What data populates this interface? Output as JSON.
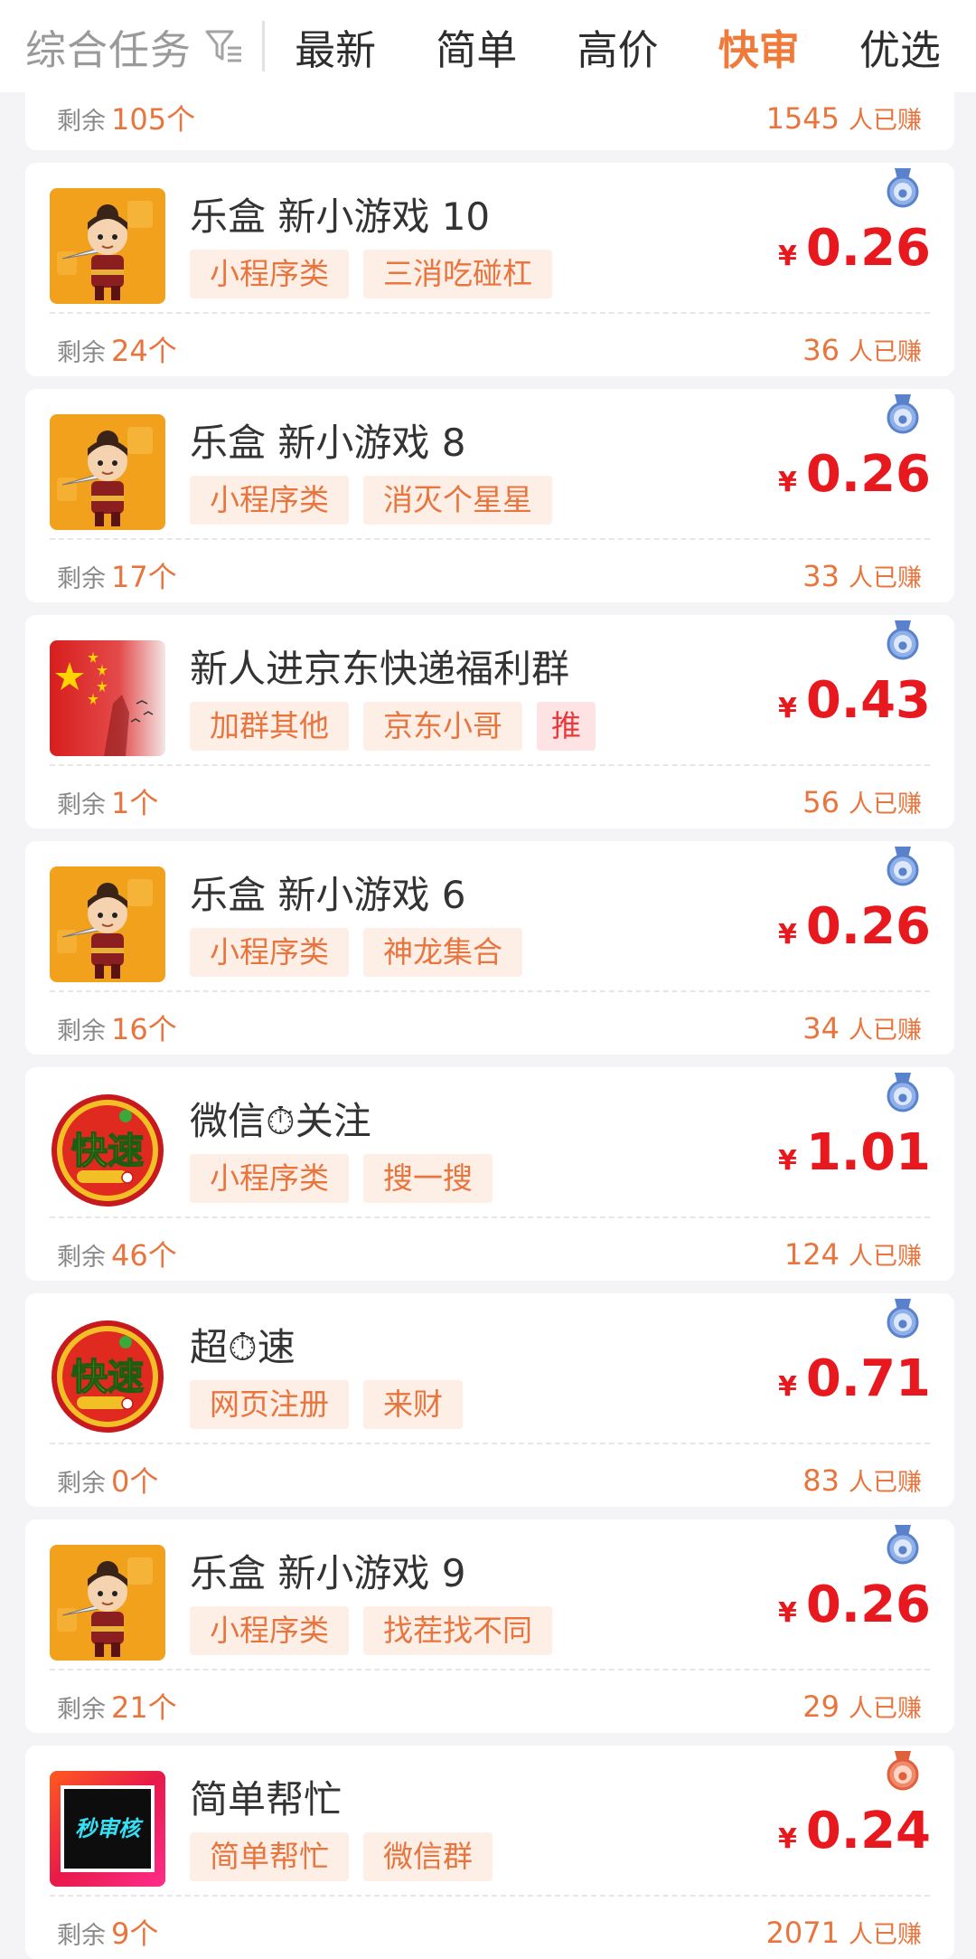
{
  "top_nav": {
    "filter_label": "综合任务",
    "tabs": [
      "最新",
      "简单",
      "高价",
      "快审",
      "优选"
    ],
    "active_tab": "快审"
  },
  "partial_card": {
    "remain_label": "剩余",
    "remain_count": "105个",
    "earned_count": "1545",
    "earned_label": "人已赚"
  },
  "cards": [
    {
      "title": "乐盒 新小游戏 10",
      "tags": [
        "小程序类",
        "三消吃碰杠"
      ],
      "price": "0.26",
      "remain_count": "24个",
      "earned_count": "36",
      "thumb": "ninja-game-icon",
      "medal": "silver-medal-icon"
    },
    {
      "title": "乐盒 新小游戏 8",
      "tags": [
        "小程序类",
        "消灭个星星"
      ],
      "price": "0.26",
      "remain_count": "17个",
      "earned_count": "33",
      "thumb": "ninja-game-icon",
      "medal": "silver-medal-icon"
    },
    {
      "title": "新人进京东快递福利群",
      "tags": [
        "加群其他",
        "京东小哥",
        "推"
      ],
      "price": "0.43",
      "remain_count": "1个",
      "earned_count": "56",
      "thumb": "china-flag-icon",
      "medal": "silver-medal-icon"
    },
    {
      "title": "乐盒 新小游戏 6",
      "tags": [
        "小程序类",
        "神龙集合"
      ],
      "price": "0.26",
      "remain_count": "16个",
      "earned_count": "34",
      "thumb": "ninja-game-icon",
      "medal": "silver-medal-icon"
    },
    {
      "title": "微信⏱关注",
      "tags": [
        "小程序类",
        "搜一搜"
      ],
      "price": "1.01",
      "remain_count": "46个",
      "earned_count": "124",
      "thumb": "kuaisu-badge-icon",
      "medal": "silver-medal-icon"
    },
    {
      "title": "超⏱速",
      "tags": [
        "网页注册",
        "来财"
      ],
      "price": "0.71",
      "remain_count": "0个",
      "earned_count": "83",
      "thumb": "kuaisu-badge-icon",
      "medal": "silver-medal-icon"
    },
    {
      "title": "乐盒 新小游戏 9",
      "tags": [
        "小程序类",
        "找茬找不同"
      ],
      "price": "0.26",
      "remain_count": "21个",
      "earned_count": "29",
      "thumb": "ninja-game-icon",
      "medal": "silver-medal-icon"
    },
    {
      "title": "简单帮忙",
      "tags": [
        "简单帮忙",
        "微信群"
      ],
      "price": "0.24",
      "remain_count": "9个",
      "earned_count": "2071",
      "thumb": "miaoshenhe-badge-icon",
      "medal": "bronze-medal-icon"
    }
  ],
  "labels": {
    "remain_label": "剩余",
    "earned_label": "人已赚",
    "currency": "¥"
  },
  "thumb_text": {
    "kuaisu": "快速",
    "miaoshenhe": "秒审核"
  },
  "colors": {
    "accent_orange": "#f07a3a",
    "price_red": "#e8191e",
    "tag_bg": "#fdeee6",
    "tag_text": "#e8753e"
  }
}
